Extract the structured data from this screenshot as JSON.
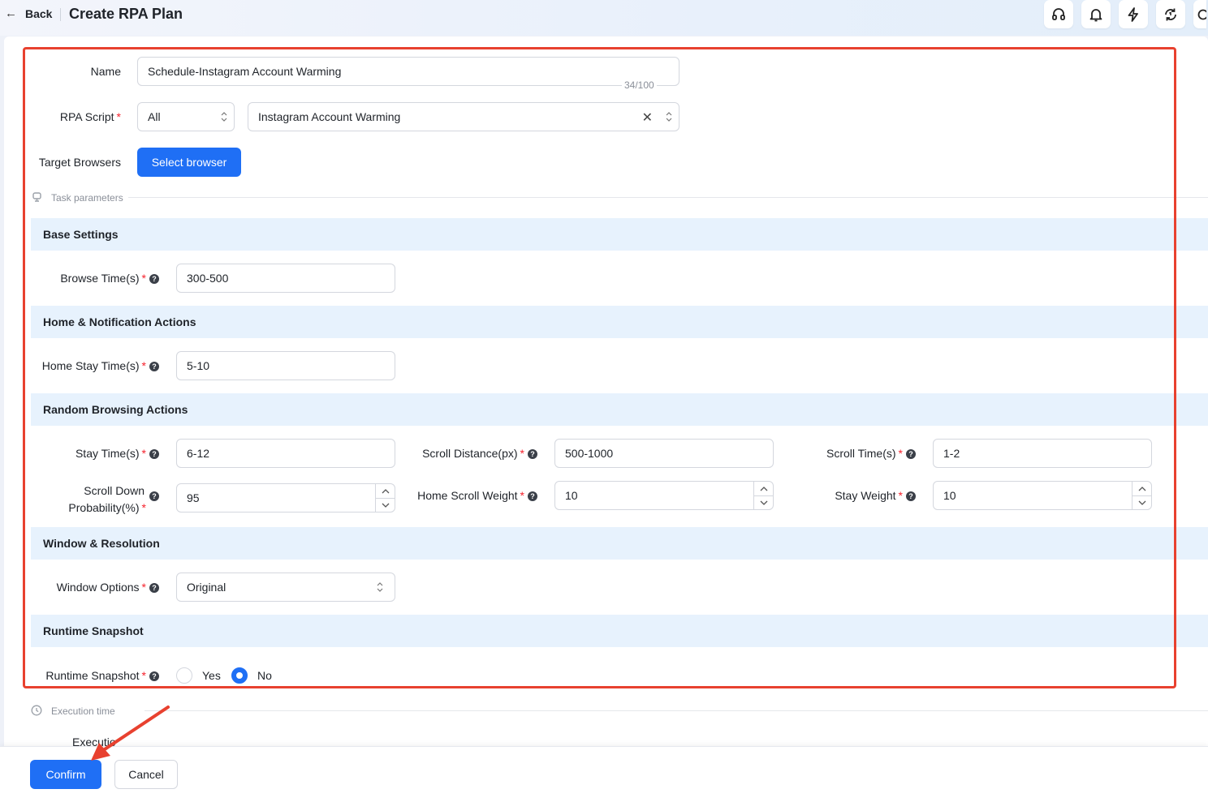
{
  "header": {
    "back_label": "Back",
    "title": "Create RPA Plan",
    "icons": [
      "headset-icon",
      "bell-icon",
      "lightning-icon",
      "sync-icon",
      "user-icon"
    ]
  },
  "form": {
    "name": {
      "label": "Name",
      "value": "Schedule-Instagram Account Warming",
      "counter": "34/100"
    },
    "rpa_script": {
      "label": "RPA Script",
      "category_value": "All",
      "script_value": "Instagram Account Warming"
    },
    "target_browsers": {
      "label": "Target Browsers",
      "button_label": "Select browser"
    }
  },
  "task_parameters_title": "Task parameters",
  "sections": {
    "base_settings": "Base Settings",
    "home_notification": "Home & Notification Actions",
    "random_browsing": "Random Browsing Actions",
    "window_resolution": "Window & Resolution",
    "runtime_snapshot": "Runtime Snapshot"
  },
  "fields": {
    "browse_time": {
      "label": "Browse Time(s)",
      "value": "300-500"
    },
    "home_stay_time": {
      "label": "Home Stay Time(s)",
      "value": "5-10"
    },
    "stay_time": {
      "label": "Stay Time(s)",
      "value": "6-12"
    },
    "scroll_distance": {
      "label": "Scroll Distance(px)",
      "value": "500-1000"
    },
    "scroll_time": {
      "label": "Scroll Time(s)",
      "value": "1-2"
    },
    "scroll_down_prob": {
      "label_line1": "Scroll Down",
      "label_line2": "Probability(%)",
      "value": "95"
    },
    "home_scroll_weight": {
      "label": "Home Scroll Weight",
      "value": "10"
    },
    "stay_weight": {
      "label": "Stay Weight",
      "value": "10"
    },
    "window_options": {
      "label": "Window Options",
      "value": "Original"
    },
    "runtime_snapshot": {
      "label": "Runtime Snapshot",
      "options": [
        "Yes",
        "No"
      ],
      "selected": "No"
    }
  },
  "execution_time_title": "Execution time",
  "execution_label_partial": "Executio",
  "footer": {
    "confirm_label": "Confirm",
    "cancel_label": "Cancel"
  },
  "colors": {
    "primary": "#1f6ff5",
    "section_bg": "#e7f2fd",
    "highlight_box": "#e8412f",
    "required": "#f5222d"
  }
}
